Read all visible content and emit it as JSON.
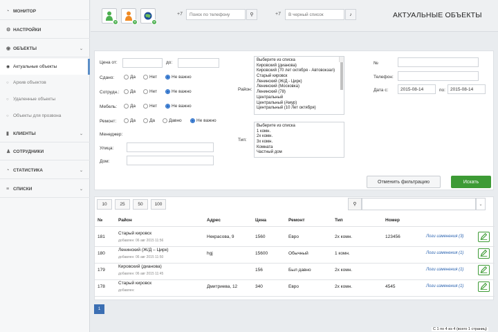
{
  "sidebar": {
    "items": [
      {
        "label": "МОНИТОР",
        "icon": "dashboard-icon"
      },
      {
        "label": "НАСТРОЙКИ",
        "icon": "settings-icon"
      },
      {
        "label": "ОБЪЕКТЫ",
        "icon": "objects-icon"
      },
      {
        "label": "КЛИЕНТЫ",
        "icon": "clients-icon"
      },
      {
        "label": "СОТРУДНИКИ",
        "icon": "employees-icon"
      },
      {
        "label": "СТАТИСТИКА",
        "icon": "statistics-icon"
      },
      {
        "label": "СПИСКИ",
        "icon": "lists-icon"
      }
    ],
    "subitems": [
      {
        "label": "Актуальные объекты"
      },
      {
        "label": "Архив объектов"
      },
      {
        "label": "Удаленные объекты"
      },
      {
        "label": "Объекты для прозвона"
      }
    ]
  },
  "toolbar": {
    "phone_prefix": "+7",
    "phone_placeholder": "Поиск по телефону",
    "black_prefix": "+7",
    "black_placeholder": "В черный список",
    "page_title": "АКТУАЛЬНЫЕ ОБЪЕКТЫ"
  },
  "filter": {
    "price_from_label": "Цена от:",
    "price_to_label": "до:",
    "rented_label": "Сдано:",
    "staff_label": "Сотрудн.:",
    "furniture_label": "Мебель:",
    "repair_label": "Ремонт:",
    "manager_label": "Менеджер:",
    "street_label": "Улица:",
    "house_label": "Дом:",
    "yes": "Да",
    "no": "Нет",
    "any": "Не важно",
    "old": "Давно",
    "district_label": "Район:",
    "districts": [
      "Выберите из списка",
      "Кировский (дианова)",
      "Кировский (70 лет октября - Автовокзал)",
      "Старый кировск",
      "Ленинский (Ж/Д - Цирк)",
      "Ленинский (Московка)",
      "Ленинский (78)",
      "Центральный",
      "Центральный (Амур)",
      "Центральный (10 Лет октября)"
    ],
    "type_label": "Тип:",
    "types": [
      "Выберите из списка",
      "1 комн.",
      "2х комн.",
      "3х комн.",
      "Комната",
      "Частный дом"
    ],
    "number_label": "№",
    "phone_label": "Телефон:",
    "date_from_label": "Дата с:",
    "date_from": "2015-08-14",
    "date_to_label": "по:",
    "date_to": "2015-08-14",
    "cancel_label": "Отменить фильтрацию",
    "search_label": "Искать"
  },
  "results": {
    "page_sizes": [
      "10",
      "25",
      "50",
      "100"
    ],
    "headers": [
      "№",
      "Район",
      "Адрес",
      "Цена",
      "Ремонт",
      "Тип",
      "Номер"
    ],
    "rows": [
      {
        "id": "181",
        "district": "Старый кировск",
        "added": "добавлен: 06 авг 2015 11:56",
        "address": "Некрасова, 9",
        "price": "1560",
        "repair": "Евро",
        "type": "2х комн.",
        "number": "123456",
        "log": "Логи изменения (3)"
      },
      {
        "id": "180",
        "district": "Ленинский (Ж/Д – Цирк)",
        "added": "добавлен: 06 авг 2015 11:50",
        "address": "hgj",
        "price": "15600",
        "repair": "Обычный",
        "type": "1 комн.",
        "number": "",
        "log": "Логи изменения (1)"
      },
      {
        "id": "179",
        "district": "Кировский (дианова)",
        "added": "добавлен: 06 авг 2015 11:45",
        "address": "",
        "price": "156",
        "repair": "Был давно",
        "type": "2х комн.",
        "number": "",
        "log": "Логи изменения (1)"
      },
      {
        "id": "178",
        "district": "Старый кировск",
        "added": "добавлен:",
        "address": "Дмитриева, 12",
        "price": "340",
        "repair": "Евро",
        "type": "2х комн.",
        "number": "4545",
        "log": "Логи изменения (1)"
      }
    ]
  },
  "footer": {
    "page": "1",
    "info": "С 1 по 4 из 4 (всего 1 страниц)"
  },
  "colors": {
    "accent_green": "#3d9b35",
    "link_blue": "#2a63b0",
    "topline": "#2e3a4a"
  }
}
